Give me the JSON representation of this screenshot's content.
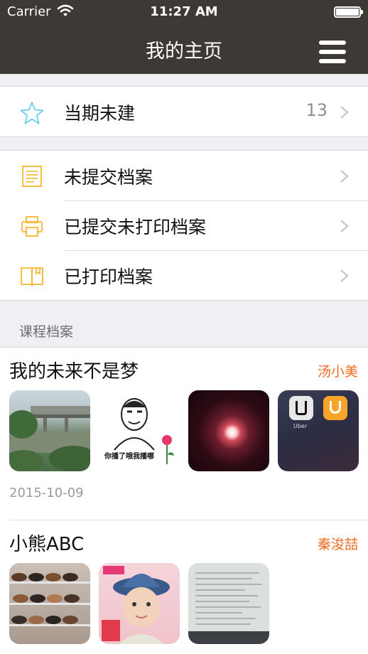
{
  "status_bar": {
    "carrier": "Carrier",
    "time": "11:27 AM"
  },
  "nav": {
    "title": "我的主页"
  },
  "group1": {
    "items": [
      {
        "label": "当期未建",
        "count": "13"
      }
    ]
  },
  "group2": {
    "items": [
      {
        "label": "未提交档案"
      },
      {
        "label": "已提交未打印档案"
      },
      {
        "label": "已打印档案"
      }
    ]
  },
  "section": {
    "header": "课程档案"
  },
  "courses": [
    {
      "title": "我的未来不是梦",
      "author": "汤小美",
      "date": "2015-10-09"
    },
    {
      "title": "小熊ABC",
      "author": "秦浚喆"
    }
  ],
  "thumb_texts": {
    "meme_caption": "你播了哦我播哪",
    "uber": "Uber"
  },
  "colors": {
    "nav_bg": "#3d3a35",
    "accent_orange": "#f26a1f",
    "icon_yellow": "#f5b82e",
    "star_blue": "#5ac8fa"
  },
  "icons": [
    "wifi-icon",
    "battery-icon",
    "menu-icon",
    "star-icon",
    "document-icon",
    "printer-icon",
    "book-icon",
    "chevron-right-icon"
  ]
}
